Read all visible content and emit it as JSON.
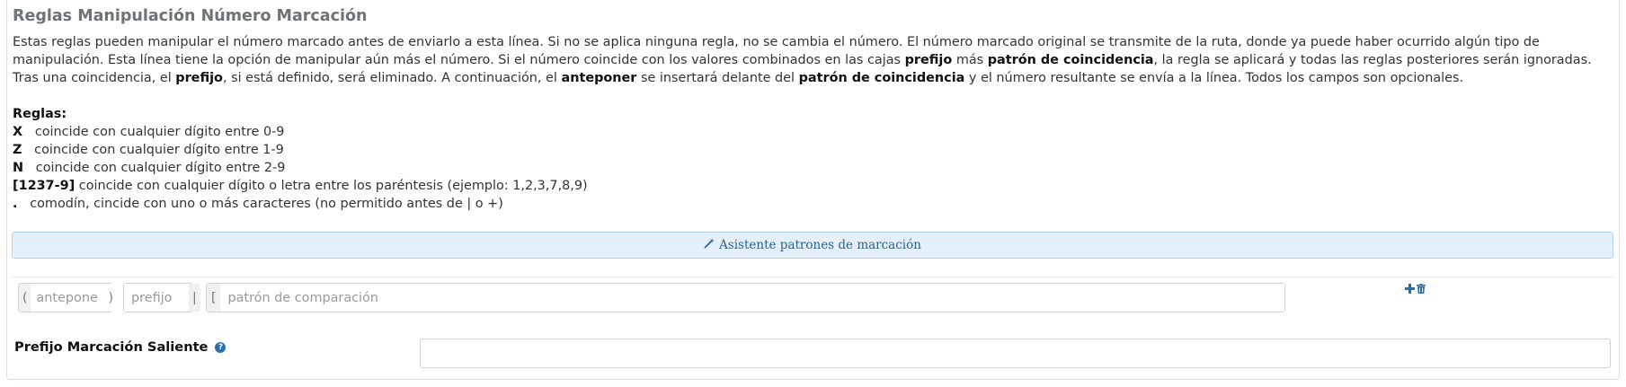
{
  "section": {
    "title": "Reglas Manipulación Número Marcación"
  },
  "description": {
    "p1_a": "Estas reglas pueden manipular el número marcado antes de enviarlo a esta línea. Si no se aplica ninguna regla, no se cambia el número. El número marcado original se transmite de la ruta, donde ya puede haber ocurrido algún tipo de manipulación. Esta línea tiene la opción de manipular aún más el número. Si el número coincide con los valores combinados en las cajas ",
    "p1_b1": "prefijo",
    "p1_c": " más ",
    "p1_b2": "patrón de coincidencia",
    "p1_d": ", la regla se aplicará y todas las reglas posteriores serán ignoradas.",
    "p2_a": "Tras una coincidencia, el ",
    "p2_b1": "prefijo",
    "p2_c": ", si está definido, será eliminado. A continuación, el ",
    "p2_b2": "anteponer",
    "p2_d": " se insertará delante del ",
    "p2_b3": "patrón de coincidencia",
    "p2_e": " y el número resultante se envía a la línea. Todos los campos son opcionales."
  },
  "rules": {
    "heading": "Reglas:",
    "items": [
      {
        "key": "X",
        "text": "coincide con cualquier dígito entre 0-9"
      },
      {
        "key": "Z",
        "text": "coincide con cualquier dígito entre 1-9"
      },
      {
        "key": "N",
        "text": "coincide con cualquier dígito entre 2-9"
      },
      {
        "key": "[1237-9]",
        "text": "coincide con cualquier dígito o letra entre los paréntesis (ejemplo: 1,2,3,7,8,9)"
      },
      {
        "key": ".",
        "text": "comodín, cincide con uno o más caracteres (no permitido antes de | o +)"
      }
    ]
  },
  "wizard": {
    "label": "Asistente patrones de marcación",
    "icon": "magic-wand-icon"
  },
  "pattern_row": {
    "prepend_open": "(",
    "prepend_close": ")",
    "prepend_placeholder": "anteponer",
    "prefix_placeholder": "prefijo",
    "prefix_separator": "|",
    "match_open": "[",
    "match_placeholder": "patrón de comparación",
    "add_icon": "plus-icon",
    "delete_icon": "trash-icon"
  },
  "outbound": {
    "label": "Prefijo Marcación Saliente",
    "help_icon": "question-circle-icon",
    "value": ""
  }
}
